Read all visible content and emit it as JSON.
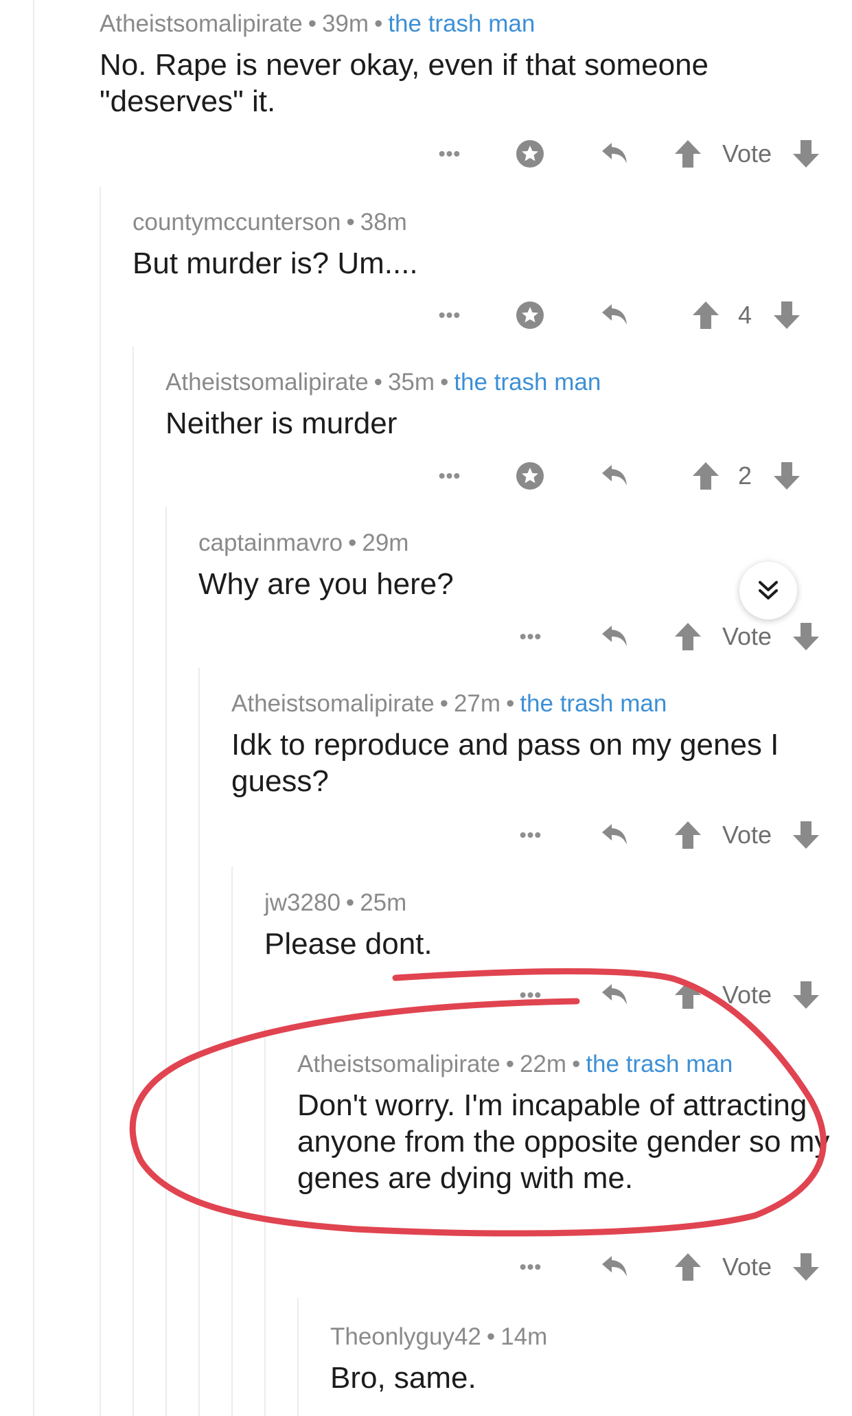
{
  "comments": [
    {
      "author": "Atheistsomalipirate",
      "age": "39m",
      "flair": "the trash man",
      "text": "No. Rape is never okay, even if that someone \"deserves\" it.",
      "vote": "Vote"
    },
    {
      "author": "countymccunterson",
      "age": "38m",
      "flair": "",
      "text": "But murder is?  Um....",
      "vote": "4"
    },
    {
      "author": "Atheistsomalipirate",
      "age": "35m",
      "flair": "the trash man",
      "text": "Neither is murder",
      "vote": "2"
    },
    {
      "author": "captainmavro",
      "age": "29m",
      "flair": "",
      "text": "Why are you here?",
      "vote": "Vote"
    },
    {
      "author": "Atheistsomalipirate",
      "age": "27m",
      "flair": "the trash man",
      "text": "Idk to reproduce and pass on my genes I guess?",
      "vote": "Vote"
    },
    {
      "author": "jw3280",
      "age": "25m",
      "flair": "",
      "text": "Please dont.",
      "vote": "Vote"
    },
    {
      "author": "Atheistsomalipirate",
      "age": "22m",
      "flair": "the trash man",
      "text": "Don't worry. I'm incapable of attracting anyone from the opposite gender so my genes are dying with me.",
      "vote": "Vote"
    },
    {
      "author": "Theonlyguy42",
      "age": "14m",
      "flair": "",
      "text": "Bro, same.",
      "vote": ""
    }
  ],
  "separator": "•",
  "more_glyph": "•••",
  "colors": {
    "flair": "#3c8fd6",
    "annotation": "#e04450",
    "meta": "#8a8a8a"
  },
  "icons": [
    "more-icon",
    "save-icon",
    "reply-icon",
    "upvote-icon",
    "downvote-icon",
    "jump-down-icon"
  ]
}
